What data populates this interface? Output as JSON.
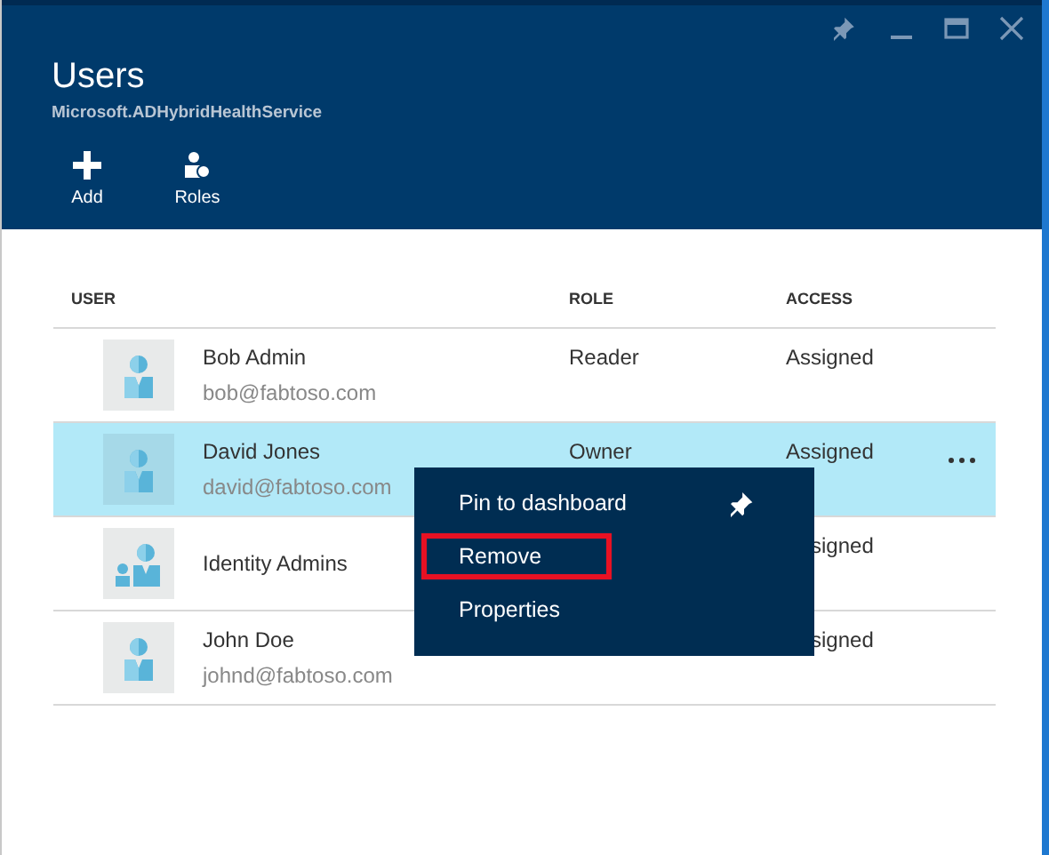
{
  "window": {
    "title": "Users",
    "subtitle": "Microsoft.ADHybridHealthService"
  },
  "window_controls": [
    {
      "kind": "pin"
    },
    {
      "kind": "minimize"
    },
    {
      "kind": "maximize"
    },
    {
      "kind": "close"
    }
  ],
  "commands": [
    {
      "label": "Add",
      "kind": "add"
    },
    {
      "label": "Roles",
      "kind": "roles"
    }
  ],
  "table": {
    "columns": [
      "USER",
      "ROLE",
      "ACCESS"
    ],
    "rows": [
      {
        "name": "Bob Admin",
        "email": "bob@fabtoso.com",
        "kind": "user",
        "role": "Reader",
        "access": "Assigned",
        "selected": false
      },
      {
        "name": "David Jones",
        "email": "david@fabtoso.com",
        "kind": "user",
        "role": "Owner",
        "access": "Assigned",
        "selected": true
      },
      {
        "name": "Identity Admins",
        "kind": "group",
        "access": "signed",
        "clipped": true,
        "selected": false
      },
      {
        "name": "John Doe",
        "email": "johnd@fabtoso.com",
        "kind": "user",
        "access": "signed",
        "clipped": true,
        "selected": false
      }
    ]
  },
  "context_menu": {
    "items": [
      {
        "label": "Pin to dashboard",
        "kind": "pin",
        "highlighted": false
      },
      {
        "label": "Remove",
        "kind": "plain",
        "highlighted": true
      },
      {
        "label": "Properties",
        "kind": "plain",
        "highlighted": false
      }
    ]
  }
}
